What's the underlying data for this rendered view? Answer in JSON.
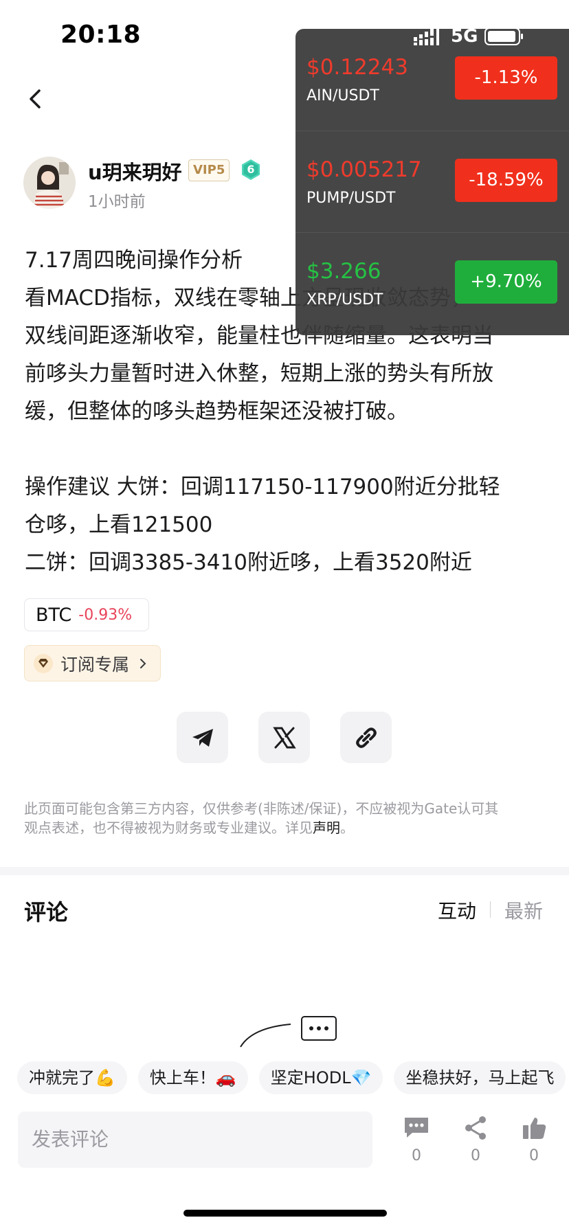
{
  "status_bar": {
    "time": "20:18",
    "network": "5G"
  },
  "author": {
    "name": "u玥来玥好",
    "vip": "VIP5",
    "level": "6",
    "posted": "1小时前"
  },
  "article": {
    "lines": [
      "7.17周四晚间操作分析",
      "看MACD指标，双线在零轴上方呈现收敛态势，",
      "双线间距逐渐收窄，能量柱也伴随缩量。这表明当",
      "前哆头力量暂时进入休整，短期上涨的势头有所放",
      "缓，但整体的哆头趋势框架还没被打破。",
      "",
      "操作建议 大饼：回调117150-117900附近分批轻",
      "仓哆，上看121500",
      "二饼：回调3385-3410附近哆，上看3520附近"
    ]
  },
  "coin_tag": {
    "symbol": "BTC",
    "change": "-0.93%"
  },
  "subscribe": {
    "label": "订阅专属"
  },
  "disclaimer": {
    "line1": "此页面可能包含第三方内容，仅供参考(非陈述/保证)，不应被视为Gate认可其",
    "line2": "观点表述，也不得被视为财务或专业建议。详见",
    "link": "声明",
    "end": "。"
  },
  "comments": {
    "title": "评论",
    "sort_active": "互动",
    "sort_inactive": "最新",
    "quick_replies": [
      "冲就完了💪",
      "快上车！🚗",
      "坚定HODL💎",
      "坐稳扶好，马上起飞"
    ],
    "input_placeholder": "发表评论",
    "counts": {
      "comments": "0",
      "shares": "0",
      "likes": "0"
    }
  },
  "tickers": [
    {
      "price": "$0.12243",
      "pair": "AIN/USDT",
      "change": "-1.13%",
      "trend": "down"
    },
    {
      "price": "$0.005217",
      "pair": "PUMP/USDT",
      "change": "-18.59%",
      "trend": "down"
    },
    {
      "price": "$3.266",
      "pair": "XRP/USDT",
      "change": "+9.70%",
      "trend": "up"
    }
  ],
  "colors": {
    "down": "#f0301c",
    "up": "#1fae3c",
    "up_text": "#25c244",
    "down_text": "#ef3b2c"
  },
  "icons": [
    "back-icon",
    "telegram-icon",
    "x-icon",
    "link-icon",
    "diamond-icon",
    "chevron-right-icon",
    "comment-icon",
    "share-icon",
    "like-icon"
  ]
}
